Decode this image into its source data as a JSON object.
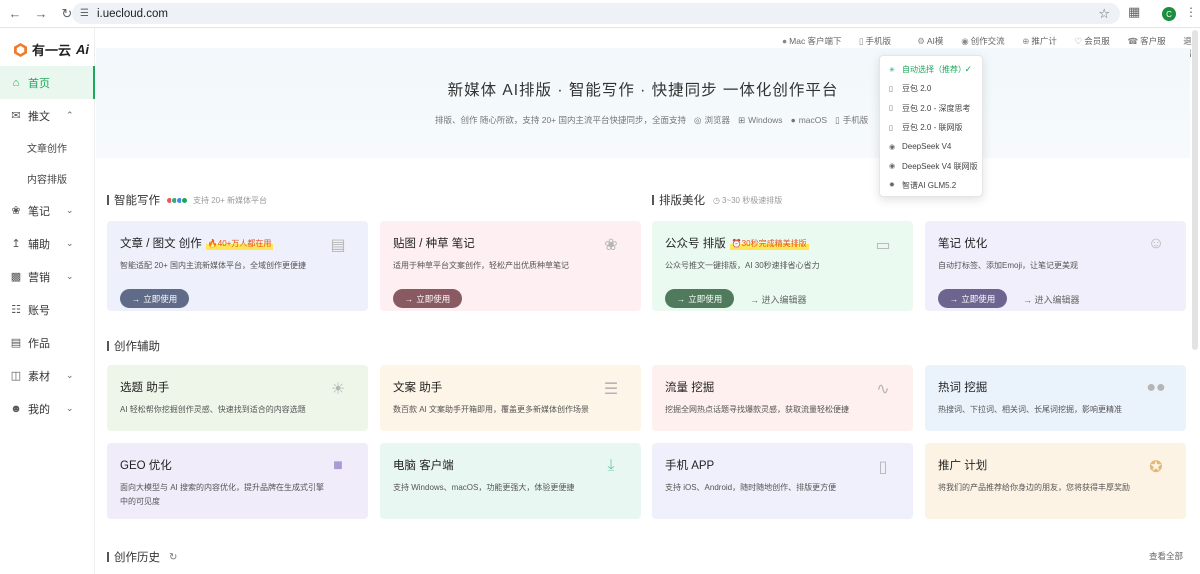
{
  "browser": {
    "url": "i.uecloud.com",
    "profile_initial": "C"
  },
  "app": {
    "logo_text": "有一云"
  },
  "sidebar": {
    "items": [
      {
        "label": "首页",
        "icon": "home-icon",
        "active": true
      },
      {
        "label": "推文",
        "icon": "mail-icon",
        "expanded": true
      },
      {
        "label": "文章创作",
        "sub": true
      },
      {
        "label": "内容排版",
        "sub": true
      },
      {
        "label": "笔记",
        "icon": "leaf-icon"
      },
      {
        "label": "辅助",
        "icon": "chart-icon"
      },
      {
        "label": "营销",
        "icon": "bar-chart-icon"
      },
      {
        "label": "账号",
        "icon": "account-icon"
      },
      {
        "label": "作品",
        "icon": "works-icon"
      },
      {
        "label": "素材",
        "icon": "material-icon"
      },
      {
        "label": "我的",
        "icon": "user-icon"
      }
    ]
  },
  "toplinks": [
    "Mac 客户端下载",
    "手机版APP",
    "AI模型",
    "创作交流群",
    "推广计划",
    "会员服务",
    "客户服务",
    "退出"
  ],
  "hero": {
    "title": "新媒体 AI排版 · 智能写作 · 快捷同步 一体化创作平台",
    "subtitle": "排版、创作 随心所欲，支持 20+ 国内主流平台快捷同步，全面支持",
    "platforms": [
      "浏览器",
      "Windows",
      "macOS",
      "手机版"
    ]
  },
  "model_dropdown": {
    "items": [
      {
        "label": "自动选择（推荐）",
        "selected": true
      },
      {
        "label": "豆包 2.0"
      },
      {
        "label": "豆包 2.0 - 深度思考"
      },
      {
        "label": "豆包 2.0 - 联网版"
      },
      {
        "label": "DeepSeek V4"
      },
      {
        "label": "DeepSeek V4 联网版"
      },
      {
        "label": "智谱AI GLM5.2"
      }
    ]
  },
  "sections": {
    "smart_writing": {
      "title": "智能写作",
      "note": "支持 20+ 新媒体平台"
    },
    "layout": {
      "title": "排版美化",
      "note": "3~30 秒极速排版"
    },
    "assist": {
      "title": "创作辅助"
    },
    "history": {
      "title": "创作历史",
      "view_all": "查看全部"
    }
  },
  "cards_top": [
    {
      "title": "文章 / 图文 创作",
      "badge": "40+万人都在用",
      "desc": "智能适配 20+ 国内主流新媒体平台，全域创作更便捷",
      "button": "立即使用",
      "bg": "#eef1fb",
      "btn_color": "#5f6b88"
    },
    {
      "title": "贴图 / 种草 笔记",
      "desc": "适用于种草平台文案创作，轻松产出优质种草笔记",
      "button": "立即使用",
      "bg": "#fdeff2",
      "btn_color": "#8a5a62"
    },
    {
      "title": "公众号 排版",
      "badge": "30秒完成精美排版",
      "desc": "公众号推文一键排版，AI 30秒速排省心省力",
      "button": "立即使用",
      "link": "进入编辑器",
      "bg": "#eafaf0",
      "btn_color": "#4f7a5c"
    },
    {
      "title": "笔记 优化",
      "desc": "自动打标签、添加Emoji，让笔记更美观",
      "button": "立即使用",
      "link": "进入编辑器",
      "bg": "#f1effb",
      "btn_color": "#6d6590"
    }
  ],
  "cards_assist": [
    {
      "title": "选题 助手",
      "desc": "AI 轻松帮你挖掘创作灵感、快速找到适合的内容选题",
      "bg": "#eef6e9"
    },
    {
      "title": "文案 助手",
      "desc": "数百款 AI 文案助手开箱即用，覆盖更多新媒体创作场景",
      "bg": "#fdf5e7"
    },
    {
      "title": "流量 挖掘",
      "desc": "挖掘全网热点话题寻找爆款灵感，获取流量轻松便捷",
      "bg": "#fdf0ee"
    },
    {
      "title": "热词 挖掘",
      "desc": "热搜词、下拉词、相关词、长尾词挖掘，影响更精准",
      "bg": "#eaf2fb"
    },
    {
      "title": "GEO 优化",
      "desc": "面向大模型与 AI 搜索的内容优化，提升品牌在生成式引擎中的可见度",
      "bg": "#f0ecfa"
    },
    {
      "title": "电脑 客户端",
      "desc": "支持 Windows、macOS，功能更强大，体验更便捷",
      "bg": "#e9f7f2"
    },
    {
      "title": "手机 APP",
      "desc": "支持 iOS、Android，随时随地创作、排版更方便",
      "bg": "#eff0fb"
    },
    {
      "title": "推广 计划",
      "desc": "将我们的产品推荐给你身边的朋友，您将获得丰厚奖励",
      "bg": "#fdf3e4"
    }
  ]
}
